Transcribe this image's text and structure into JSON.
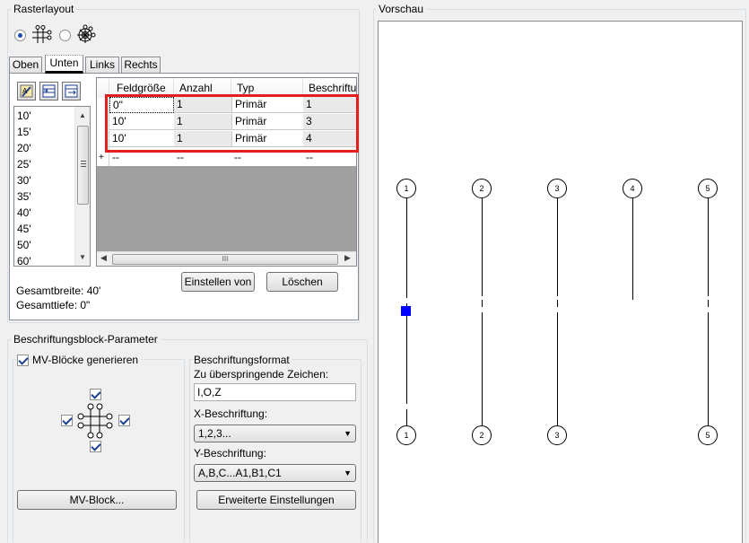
{
  "raster": {
    "title": "Rasterlayout",
    "tabs": [
      "Oben",
      "Unten",
      "Links",
      "Rechts"
    ],
    "active_tab": "Unten",
    "sizes": [
      "10'",
      "15'",
      "20'",
      "25'",
      "30'",
      "35'",
      "40'",
      "45'",
      "50'",
      "60'"
    ],
    "columns": [
      "Feldgröße",
      "Anzahl",
      "Typ",
      "Beschriftun"
    ],
    "rows": [
      {
        "feld": "0\"",
        "anzahl": "1",
        "typ": "Primär",
        "beschriftung": "1"
      },
      {
        "feld": "10'",
        "anzahl": "1",
        "typ": "Primär",
        "beschriftung": "3"
      },
      {
        "feld": "10'",
        "anzahl": "1",
        "typ": "Primär",
        "beschriftung": "4"
      }
    ],
    "new_row": {
      "marker": "+",
      "feld": "--",
      "anzahl": "--",
      "typ": "--",
      "beschriftung": "--"
    },
    "hscroll_grip": "III",
    "btn_einstellen": "Einstellen von",
    "btn_loeschen": "Löschen",
    "gesamtbreite": "Gesamtbreite: 40'",
    "gesamttiefe": "Gesamttiefe: 0\""
  },
  "params": {
    "title": "Beschriftungsblock-Parameter",
    "mv_generate": "MV-Blöcke generieren",
    "mv_button": "MV-Block...",
    "format_title": "Beschriftungsformat",
    "skip_label": "Zu überspringende Zeichen:",
    "skip_value": "I,O,Z",
    "x_label": "X-Beschriftung:",
    "x_value": "1,2,3...",
    "y_label": "Y-Beschriftung:",
    "y_value": "A,B,C...A1,B1,C1",
    "advanced_button": "Erweiterte Einstellungen"
  },
  "preview": {
    "title": "Vorschau",
    "top_bubbles": [
      "1",
      "2",
      "3",
      "4",
      "5"
    ],
    "bottom_bubbles": [
      "1",
      "2",
      "3",
      "5"
    ]
  },
  "colors": {
    "highlight": "#e31e1e",
    "accent": "#0000ff"
  }
}
